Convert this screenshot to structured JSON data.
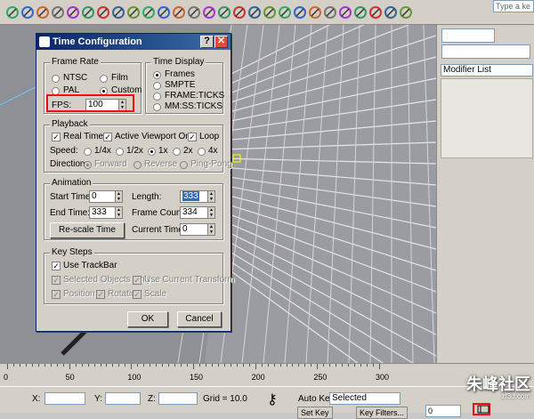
{
  "toolbar": {
    "icons": [
      "undo-icon",
      "select-icon",
      "link-icon",
      "unlink-icon",
      "bind-icon",
      "select-object-icon",
      "select-name-icon",
      "rect-select-icon",
      "window-select-icon",
      "move-icon",
      "rotate-icon",
      "scale-icon",
      "view-icon",
      "pivot-icon",
      "snap-icon",
      "angle-snap-icon",
      "percent-snap-icon",
      "spinner-snap-icon",
      "mirror-icon",
      "align-icon",
      "layer-icon",
      "curve-icon",
      "schematic-icon",
      "material-icon",
      "render-setup-icon",
      "render-icon",
      "quick-render-icon"
    ],
    "search_placeholder": "Type a ke"
  },
  "dialog": {
    "title": "Time Configuration",
    "help_label": "?",
    "close_label": "✕",
    "frame_rate": {
      "title": "Frame Rate",
      "options": [
        "NTSC",
        "Film",
        "PAL",
        "Custom"
      ],
      "selected": "Custom",
      "fps_label": "FPS:",
      "fps_value": "100"
    },
    "time_display": {
      "title": "Time Display",
      "options": [
        "Frames",
        "SMPTE",
        "FRAME:TICKS",
        "MM:SS:TICKS"
      ],
      "selected": "Frames"
    },
    "playback": {
      "title": "Playback",
      "real_time": "Real Time",
      "active_viewport_only": "Active Viewport Only",
      "loop": "Loop",
      "speed_label": "Speed:",
      "speeds": [
        "1/4x",
        "1/2x",
        "1x",
        "2x",
        "4x"
      ],
      "speed_selected": "1x",
      "direction_label": "Direction:",
      "directions": [
        "Forward",
        "Reverse",
        "Ping-Pong"
      ]
    },
    "animation": {
      "title": "Animation",
      "start_time_label": "Start Time:",
      "start_time": "0",
      "length_label": "Length:",
      "length": "333",
      "end_time_label": "End Time:",
      "end_time": "333",
      "frame_count_label": "Frame Count:",
      "frame_count": "334",
      "rescale_label": "Re-scale Time",
      "current_time_label": "Current Time:",
      "current_time": "0"
    },
    "key_steps": {
      "title": "Key Steps",
      "use_trackbar": "Use TrackBar",
      "selected_objects_only": "Selected Objects Only",
      "use_current_transform": "Use Current Transform",
      "position": "Position",
      "rotation": "Rotation",
      "scale": "Scale"
    },
    "ok_label": "OK",
    "cancel_label": "Cancel"
  },
  "right_panel": {
    "modifier_list": "Modifier List"
  },
  "timeline": {
    "ticks": [
      "0",
      "50",
      "100",
      "150",
      "200",
      "250",
      "300"
    ]
  },
  "statusbar": {
    "x_label": "X:",
    "y_label": "Y:",
    "z_label": "Z:",
    "grid_label": "Grid = 10.0",
    "auto_key": "Auto Key",
    "selected": "Selected",
    "set_key": "Set Key",
    "key_filters": "Key Filters...",
    "frame_value": "0"
  },
  "watermark": {
    "text": "朱峰社区",
    "url": "zf3d.com"
  },
  "colors": {
    "titlebar": "#0a246a",
    "highlight": "#e11111",
    "viewport": "#8f8f96"
  }
}
